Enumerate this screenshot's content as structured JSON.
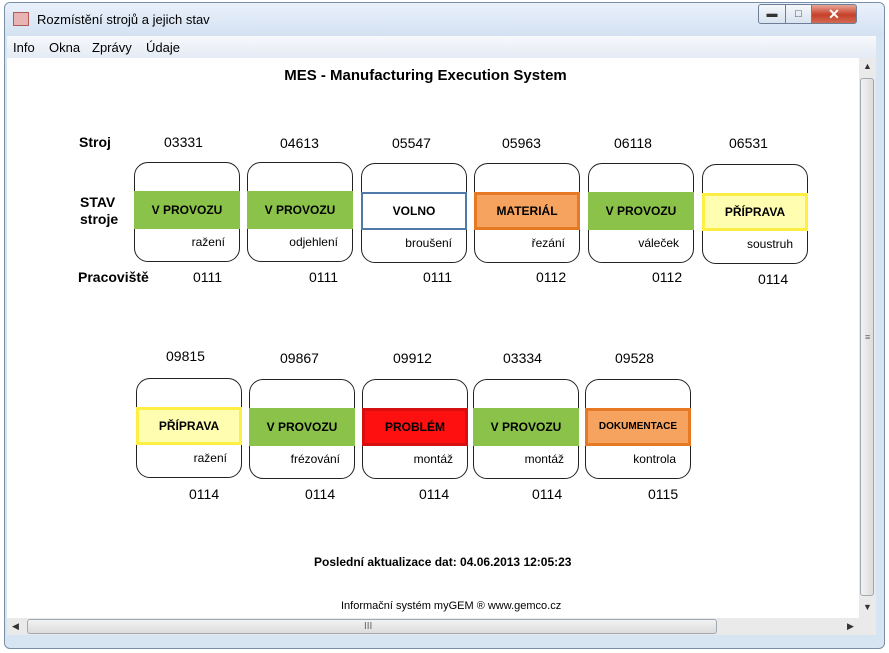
{
  "window": {
    "title": "Rozmístění strojů a jejich stav",
    "app_icon": "app-icon",
    "controls": {
      "minimize": "minimize-icon",
      "maximize": "maximize-icon",
      "close": "close-icon"
    }
  },
  "menu": {
    "items": [
      "Info",
      "Okna",
      "Zprávy",
      "Údaje"
    ]
  },
  "main": {
    "title": "MES - Manufacturing Execution System",
    "labels": {
      "machine": "Stroj",
      "state_line1": "STAV",
      "state_line2": "stroje",
      "workplace": "Pracoviště"
    },
    "row1": [
      {
        "id": "03331",
        "status": "V PROVOZU",
        "color": "#8bc34a",
        "operation": "ražení",
        "workplace": "0111"
      },
      {
        "id": "04613",
        "status": "V PROVOZU",
        "color": "#8bc34a",
        "operation": "odjehlení",
        "workplace": "0111"
      },
      {
        "id": "05547",
        "status": "VOLNO",
        "color": "#ffffff",
        "operation": "broušení",
        "workplace": "0111"
      },
      {
        "id": "05963",
        "status": "MATERIÁL",
        "color": "#f5a35f",
        "operation": "řezání",
        "workplace": "0112"
      },
      {
        "id": "06118",
        "status": "V PROVOZU",
        "color": "#8bc34a",
        "operation": "váleček",
        "workplace": "0112"
      },
      {
        "id": "06531",
        "status": "PŘÍPRAVA",
        "color": "#fffdb0",
        "operation": "soustruh",
        "workplace": "0114"
      }
    ],
    "row2": [
      {
        "id": "09815",
        "status": "PŘÍPRAVA",
        "color": "#fffdb0",
        "operation": "ražení",
        "workplace": "0114"
      },
      {
        "id": "09867",
        "status": "V PROVOZU",
        "color": "#8bc34a",
        "operation": "frézování",
        "workplace": "0114"
      },
      {
        "id": "09912",
        "status": "PROBLÉM",
        "color": "#ff1010",
        "operation": "montáž",
        "workplace": "0114"
      },
      {
        "id": "03334",
        "status": "V PROVOZU",
        "color": "#8bc34a",
        "operation": "montáž",
        "workplace": "0114"
      },
      {
        "id": "09528",
        "status": "DOKUMENTACE",
        "color": "#f5a35f",
        "operation": "kontrola",
        "workplace": "0115"
      }
    ],
    "last_update": "Poslední aktualizace dat: 04.06.2013   12:05:23",
    "footer": "Informační systém myGEM ®   www.gemco.cz"
  },
  "scrollbars": {
    "vertical_grip": "≡",
    "horizontal_grip": "III"
  }
}
